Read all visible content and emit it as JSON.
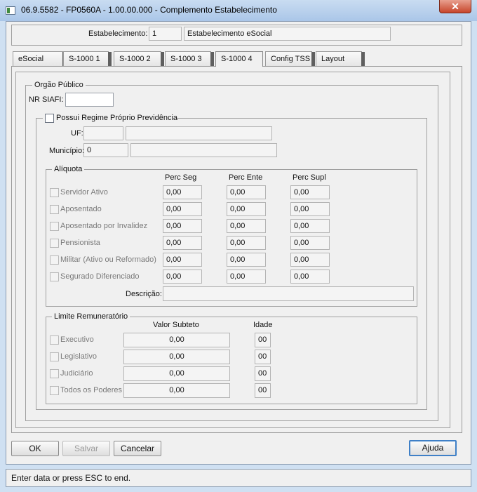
{
  "window": {
    "title": "06.9.5582 - FP0560A - 1.00.00.000 - Complemento Estabelecimento",
    "close_label": "✕"
  },
  "header": {
    "estab_label": "Estabelecimento:",
    "estab_code": "1",
    "estab_name": "Estabelecimento eSocial"
  },
  "tabs": [
    "eSocial",
    "S-1000 1",
    "S-1000 2",
    "S-1000 3",
    "S-1000 4",
    "Config TSS",
    "Layout"
  ],
  "active_tab": "S-1000 4",
  "orgao": {
    "legend": "Orgão Público",
    "nr_siafi_label": "NR SIAFI:",
    "nr_siafi_value": "",
    "regime": {
      "legend": "Possui Regime Próprio Previdência",
      "uf_label": "UF:",
      "uf_value": "",
      "uf_desc": "",
      "municipio_label": "Município:",
      "municipio_value": "0",
      "municipio_desc": "",
      "aliquota": {
        "legend": "Alíquota",
        "columns": [
          "Perc Seg",
          "Perc Ente",
          "Perc Supl"
        ],
        "rows": [
          {
            "label": "Servidor Ativo",
            "values": [
              "0,00",
              "0,00",
              "0,00"
            ]
          },
          {
            "label": "Aposentado",
            "values": [
              "0,00",
              "0,00",
              "0,00"
            ]
          },
          {
            "label": "Aposentado por Invalidez",
            "values": [
              "0,00",
              "0,00",
              "0,00"
            ]
          },
          {
            "label": "Pensionista",
            "values": [
              "0,00",
              "0,00",
              "0,00"
            ]
          },
          {
            "label": "Militar (Ativo ou Reformado)",
            "values": [
              "0,00",
              "0,00",
              "0,00"
            ]
          },
          {
            "label": "Segurado Diferenciado",
            "values": [
              "0,00",
              "0,00",
              "0,00"
            ]
          }
        ],
        "descricao_label": "Descrição:",
        "descricao_value": ""
      },
      "limite": {
        "legend": "Limite Remuneratório",
        "columns": [
          "Valor Subteto",
          "Idade"
        ],
        "rows": [
          {
            "label": "Executivo",
            "valor": "0,00",
            "idade": "00"
          },
          {
            "label": "Legislativo",
            "valor": "0,00",
            "idade": "00"
          },
          {
            "label": "Judiciário",
            "valor": "0,00",
            "idade": "00"
          },
          {
            "label": "Todos os Poderes",
            "valor": "0,00",
            "idade": "00"
          }
        ]
      }
    }
  },
  "buttons": {
    "ok": "OK",
    "salvar": "Salvar",
    "cancelar": "Cancelar",
    "ajuda": "Ajuda"
  },
  "status": "Enter data or press ESC to end."
}
